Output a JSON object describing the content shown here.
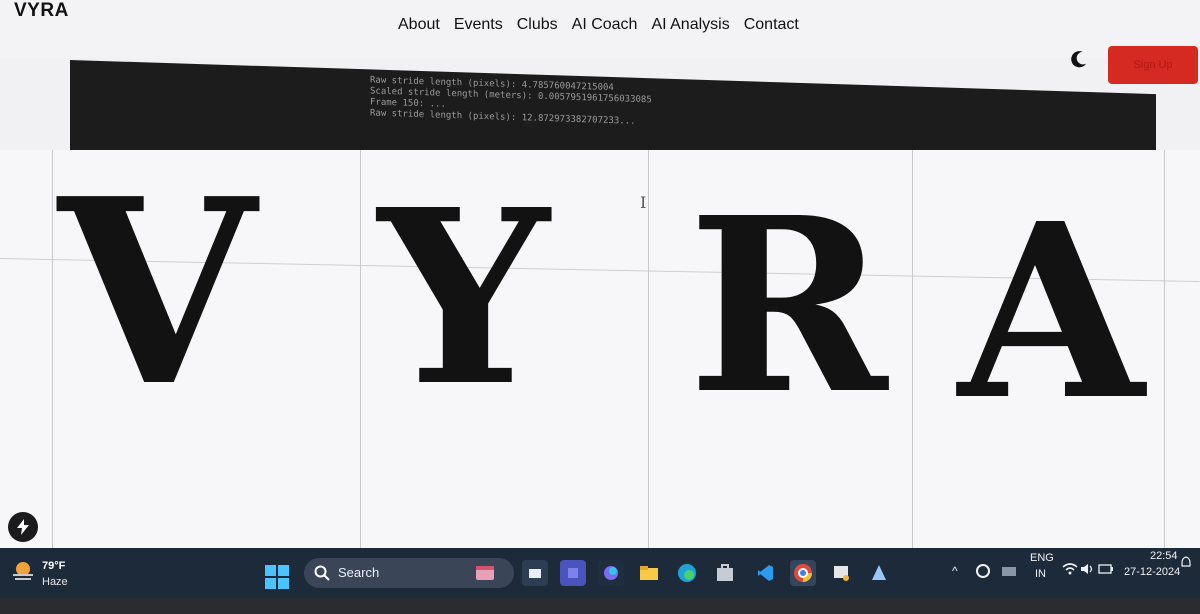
{
  "site": {
    "logo": "VYRA",
    "nav": [
      "About",
      "Events",
      "Clubs",
      "AI Coach",
      "AI Analysis",
      "Contact"
    ],
    "header_button": "Sign Up"
  },
  "debug": {
    "lines": [
      "Raw stride length (pixels): 4.785760047215004",
      "Scaled stride length (meters): 0.0057951961756033085",
      "Frame 150: ...",
      "Raw stride length (pixels): 12.872973382707233..."
    ]
  },
  "hero": {
    "letters": [
      "V",
      "Y",
      "R",
      "A"
    ]
  },
  "taskbar": {
    "weather": {
      "temp": "79°F",
      "desc": "Haze"
    },
    "search_label": "Search",
    "apps": [
      "explorer-icon",
      "teams-icon",
      "copilot-icon",
      "file-explorer-icon",
      "edge-icon",
      "store-icon",
      "vscode-icon",
      "chrome-icon",
      "app-icon",
      "paint-icon"
    ],
    "lang_top": "ENG",
    "lang_bottom": "IN",
    "time": "22:54",
    "date": "27-12-2024"
  },
  "colors": {
    "accent": "#d42a22",
    "taskbar": "#1d2a3a"
  }
}
